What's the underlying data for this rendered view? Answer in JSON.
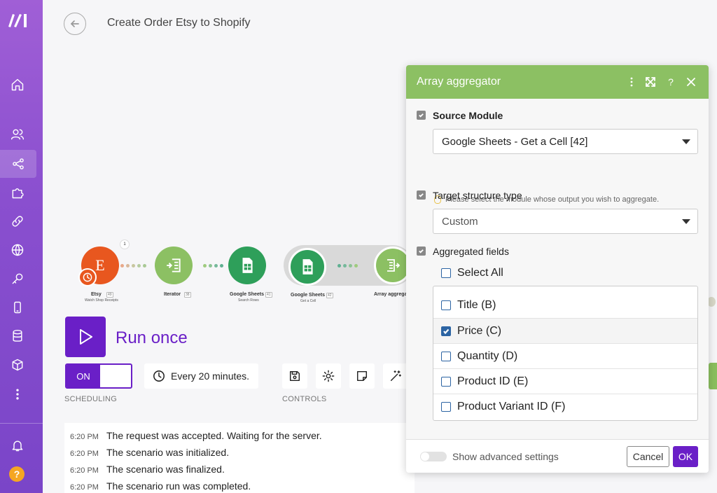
{
  "header": {
    "title": "Create Order Etsy to Shopify"
  },
  "sidebar": {
    "help_label": "?"
  },
  "flow": {
    "nodes": [
      {
        "label": "Etsy",
        "sub": "Watch Shop Receipts",
        "num": "49",
        "letter": "E",
        "bubble": "1"
      },
      {
        "label": "Iterator",
        "sub": "",
        "num": "38"
      },
      {
        "label": "Google Sheets",
        "sub": "Search Rows",
        "num": "41"
      },
      {
        "label": "Google Sheets",
        "sub": "Get a Cell",
        "num": "42"
      },
      {
        "label": "Array aggrega",
        "sub": ""
      }
    ]
  },
  "run": {
    "label": "Run once"
  },
  "scheduling": {
    "toggle": "ON",
    "interval": "Every 20 minutes.",
    "label": "SCHEDULING"
  },
  "controls": {
    "label": "CONTROLS"
  },
  "log": [
    {
      "time": "6:20 PM",
      "msg": "The request was accepted. Waiting for the server."
    },
    {
      "time": "6:20 PM",
      "msg": "The scenario was initialized."
    },
    {
      "time": "6:20 PM",
      "msg": "The scenario was finalized."
    },
    {
      "time": "6:20 PM",
      "msg": "The scenario run was completed."
    }
  ],
  "dialog": {
    "title": "Array aggregator",
    "source": {
      "label": "Source Module",
      "value": "Google Sheets - Get a Cell [42]",
      "hint": "Please select the module whose output you wish to aggregate."
    },
    "target": {
      "label": "Target structure type",
      "value": "Custom"
    },
    "fields": {
      "label": "Aggregated fields",
      "select_all": "Select All",
      "items": [
        {
          "label": "Title (B)",
          "checked": false
        },
        {
          "label": "Price (C)",
          "checked": true
        },
        {
          "label": "Quantity (D)",
          "checked": false
        },
        {
          "label": "Product ID (E)",
          "checked": false
        },
        {
          "label": "Product Variant ID (F)",
          "checked": false
        }
      ]
    },
    "footer": {
      "advanced": "Show advanced settings",
      "cancel": "Cancel",
      "ok": "OK"
    }
  },
  "colors": {
    "brand": "#6a1fc7",
    "sidebar": "#8a4fcf",
    "module_green": "#8cc063",
    "sheets_green": "#2e9f5a",
    "etsy_orange": "#e8571f"
  }
}
